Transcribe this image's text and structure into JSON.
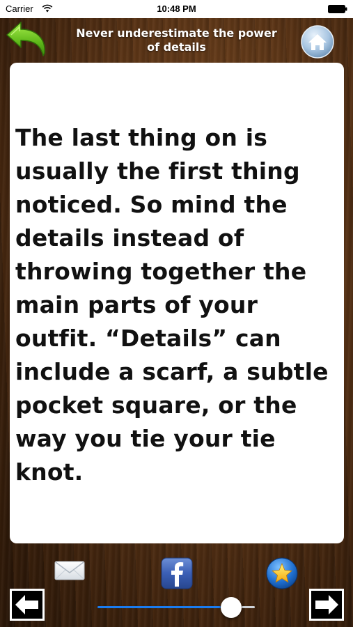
{
  "status_bar": {
    "carrier": "Carrier",
    "time": "10:48 PM"
  },
  "header": {
    "title": "Never underestimate the power of details",
    "back_icon": "back-arrow-icon",
    "home_icon": "home-icon"
  },
  "quote": {
    "text": "The last thing on is usually the first thing noticed. So mind the details instead of throwing together the main parts of your outfit. “Details” can include a scarf, a subtle pocket square, or the way you tie your tie knot."
  },
  "toolbar": {
    "mail_icon": "mail-icon",
    "facebook_icon": "facebook-icon",
    "favorite_icon": "star-icon",
    "prev_icon": "arrow-left-icon",
    "next_icon": "arrow-right-icon",
    "slider_value": 0.85
  },
  "colors": {
    "accent_blue": "#1a7cf0",
    "back_arrow_green": "#6cc21b",
    "card_background": "#ffffff"
  }
}
